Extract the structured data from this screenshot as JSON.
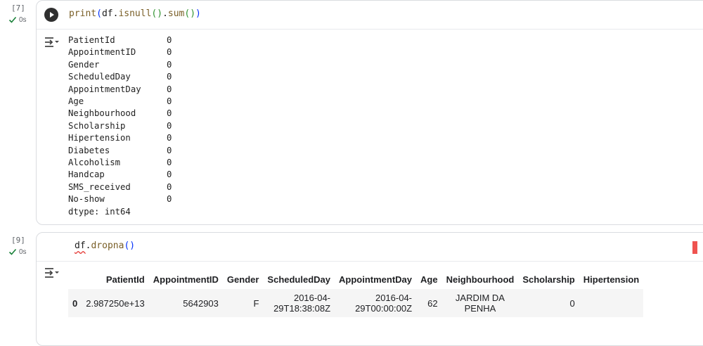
{
  "cells": [
    {
      "count": "[7]",
      "status_time": "0s",
      "code": {
        "fn": "print",
        "obj": "df",
        "method1": "isnull",
        "method2": "sum"
      },
      "output": {
        "rows": [
          {
            "name": "PatientId",
            "value": "0"
          },
          {
            "name": "AppointmentID",
            "value": "0"
          },
          {
            "name": "Gender",
            "value": "0"
          },
          {
            "name": "ScheduledDay",
            "value": "0"
          },
          {
            "name": "AppointmentDay",
            "value": "0"
          },
          {
            "name": "Age",
            "value": "0"
          },
          {
            "name": "Neighbourhood",
            "value": "0"
          },
          {
            "name": "Scholarship",
            "value": "0"
          },
          {
            "name": "Hipertension",
            "value": "0"
          },
          {
            "name": "Diabetes",
            "value": "0"
          },
          {
            "name": "Alcoholism",
            "value": "0"
          },
          {
            "name": "Handcap",
            "value": "0"
          },
          {
            "name": "SMS_received",
            "value": "0"
          },
          {
            "name": "No-show",
            "value": "0"
          }
        ],
        "dtype": "dtype: int64"
      }
    },
    {
      "count": "[9]",
      "status_time": "0s",
      "code": {
        "obj": "df",
        "method": "dropna"
      },
      "table": {
        "columns": [
          "PatientId",
          "AppointmentID",
          "Gender",
          "ScheduledDay",
          "AppointmentDay",
          "Age",
          "Neighbourhood",
          "Scholarship",
          "Hipertension"
        ],
        "rows": [
          {
            "index": "0",
            "PatientId": "2.987250e+13",
            "AppointmentID": "5642903",
            "Gender": "F",
            "ScheduledDay": "2016-04-29T18:38:08Z",
            "AppointmentDay": "2016-04-29T00:00:00Z",
            "Age": "62",
            "Neighbourhood": "JARDIM DA PENHA",
            "Scholarship": "0",
            "Hipertension": ""
          }
        ]
      }
    }
  ],
  "colors": {
    "run_button": "#2f2f2f",
    "status_check": "#188038",
    "error_marker": "#ef5350"
  }
}
